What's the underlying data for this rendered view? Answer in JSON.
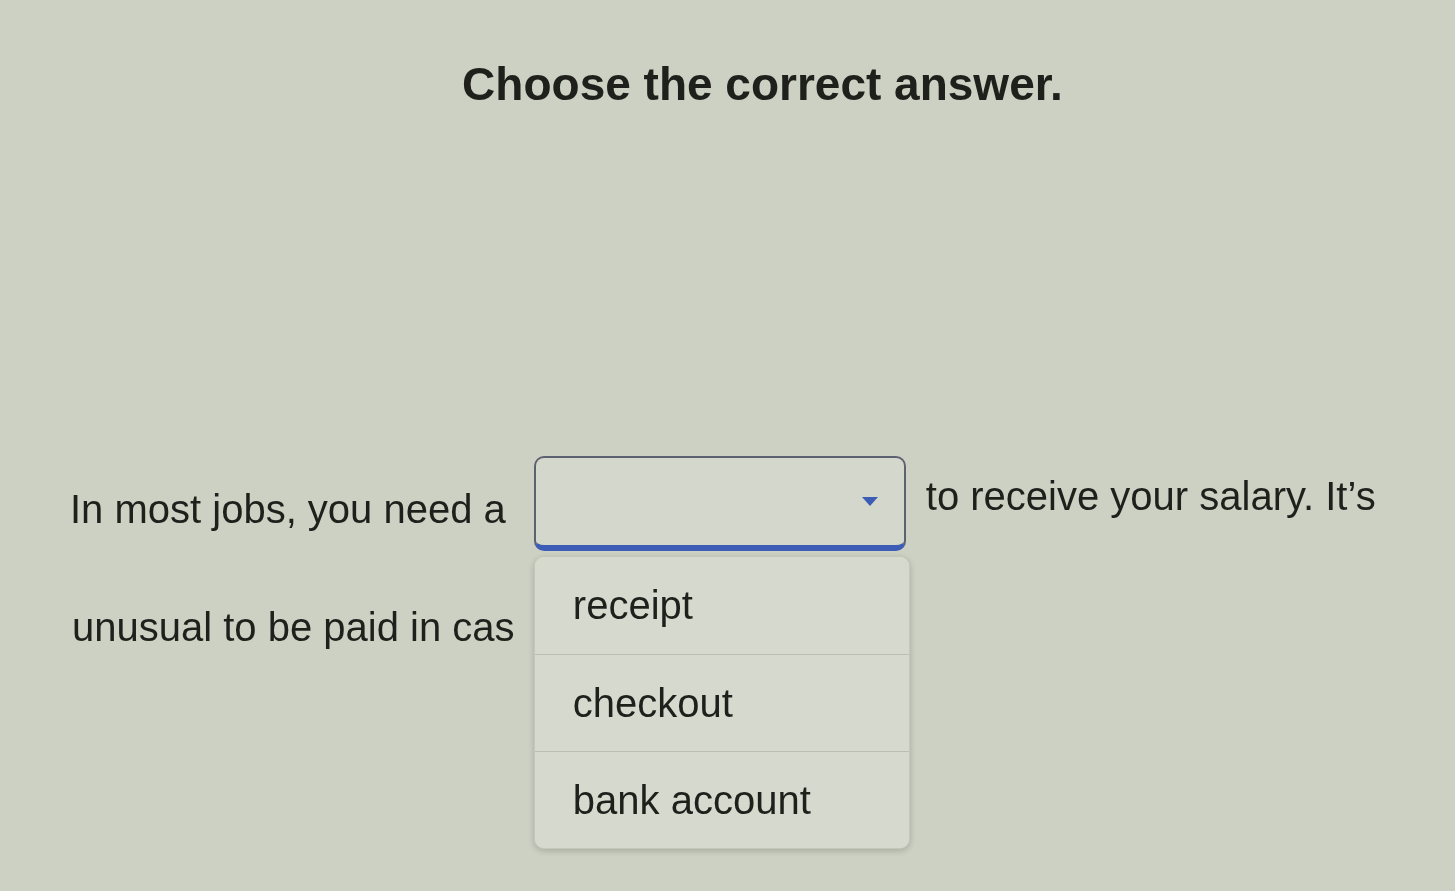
{
  "title": "Choose the correct answer.",
  "sentence": {
    "before_blank": "In most jobs, you need a",
    "after_blank": "to receive your salary. It’s",
    "line_2": "unusual to be paid in cas"
  },
  "dropdown": {
    "expanded": true,
    "options": [
      {
        "label": "receipt",
        "selected": false
      },
      {
        "label": "checkout",
        "selected": false
      },
      {
        "label": "bank account",
        "selected": false
      }
    ]
  }
}
